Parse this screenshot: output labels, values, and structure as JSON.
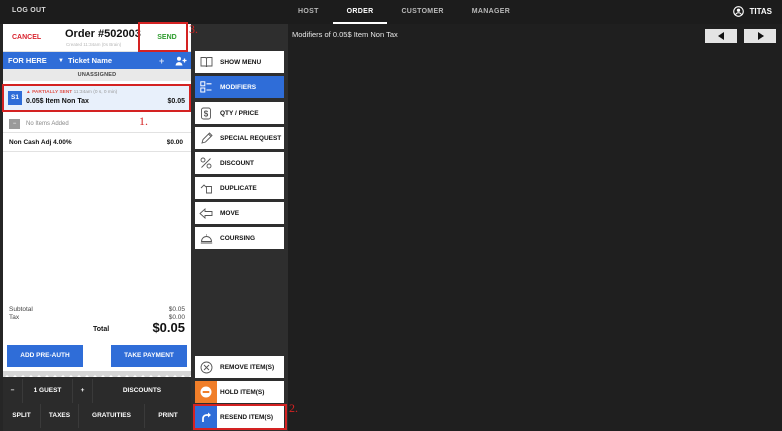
{
  "topbar": {
    "logout": "LOG OUT",
    "tabs": [
      {
        "label": "HOST"
      },
      {
        "label": "ORDER"
      },
      {
        "label": "CUSTOMER"
      },
      {
        "label": "MANAGER"
      }
    ],
    "active_tab": "ORDER",
    "user": "TITAS"
  },
  "order": {
    "cancel": "CANCEL",
    "title": "Order #502003",
    "created": "Created 11:34am (0s Brain)",
    "send": "SEND",
    "for_here": "FOR HERE",
    "ticket_name": "Ticket Name",
    "plus": "+",
    "unassigned": "UNASSIGNED",
    "item": {
      "seat": "S1",
      "status": "▲ PARTIALLY SENT",
      "status_detail": "11:34am (0 s, 0 min)",
      "name": "0.05$ Item Non Tax",
      "price": "$0.05"
    },
    "no_items": "No Items Added",
    "noncash_label": "Non Cash Adj 4.00%",
    "noncash_value": "$0.00",
    "subtotal_label": "Subtotal",
    "subtotal_value": "$0.05",
    "tax_label": "Tax",
    "tax_value": "$0.00",
    "total_label": "Total",
    "total_value": "$0.05",
    "add_preauth": "ADD PRE-AUTH",
    "take_payment": "TAKE PAYMENT"
  },
  "bottom": {
    "minus": "−",
    "guests": "1 GUEST",
    "plus": "+",
    "discounts": "DISCOUNTS",
    "split": "SPLIT",
    "taxes": "TAXES",
    "gratuities": "GRATUITIES",
    "print": "PRINT"
  },
  "actions": {
    "show_menu": "SHOW MENU",
    "modifiers": "MODIFIERS",
    "qty_price": "QTY / PRICE",
    "special_request": "SPECIAL REQUEST",
    "discount": "DISCOUNT",
    "duplicate": "DUPLICATE",
    "move": "MOVE",
    "coursing": "COURSING",
    "remove_items": "REMOVE ITEM(S)",
    "hold_items": "HOLD ITEM(S)",
    "resend_items": "RESEND ITEM(S)"
  },
  "modifiers_panel": {
    "title": "Modifiers of 0.05$ Item Non Tax"
  },
  "annotations": {
    "label_1": "1.",
    "label_2": "2.",
    "label_3": "3."
  },
  "colors": {
    "accent_blue": "#2f6dd8",
    "cancel_red": "#d9232e",
    "send_green": "#2e9c2e",
    "hold_orange": "#f07e29",
    "annotation_red": "#d42222"
  }
}
